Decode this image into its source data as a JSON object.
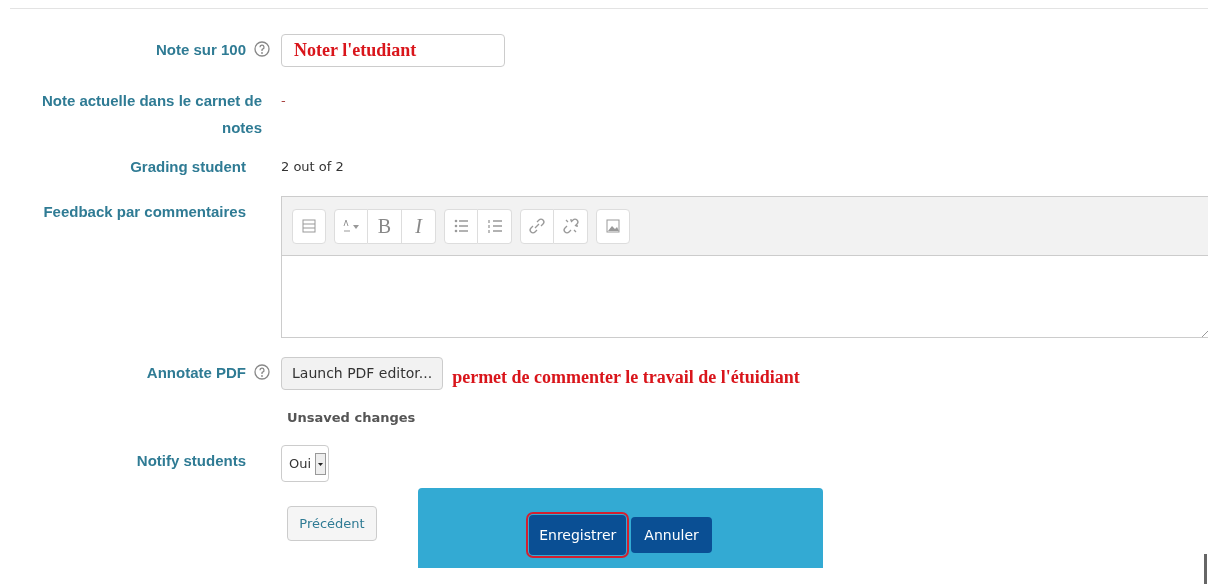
{
  "grade": {
    "label": "Note sur 100",
    "help": true,
    "value": "Noter l'etudiant"
  },
  "current_grade": {
    "label": "Note actuelle dans le carnet de notes",
    "value": "-"
  },
  "grading_student": {
    "label": "Grading student",
    "value": "2 out of 2"
  },
  "feedback": {
    "label": "Feedback par commentaires",
    "toolbar": [
      [
        {
          "kind": "icon"
        }
      ],
      [
        {
          "kind": "icon"
        },
        {
          "kind": "text",
          "label": "B"
        },
        {
          "kind": "text",
          "label": "I"
        }
      ],
      [
        {
          "kind": "icon"
        },
        {
          "kind": "icon"
        }
      ],
      [
        {
          "kind": "icon"
        },
        {
          "kind": "icon"
        }
      ],
      [
        {
          "kind": "icon"
        }
      ]
    ]
  },
  "annotate": {
    "label": "Annotate PDF",
    "help": true,
    "button": "Launch PDF editor...",
    "note": "permet de commenter le travail de l'étuidiant",
    "status": "Unsaved changes"
  },
  "notify": {
    "label": "Notify students",
    "value": "Oui"
  },
  "buttons": {
    "previous": "Précédent",
    "save": "Enregistrer",
    "save_highlighted": true,
    "cancel": "Annuler"
  }
}
